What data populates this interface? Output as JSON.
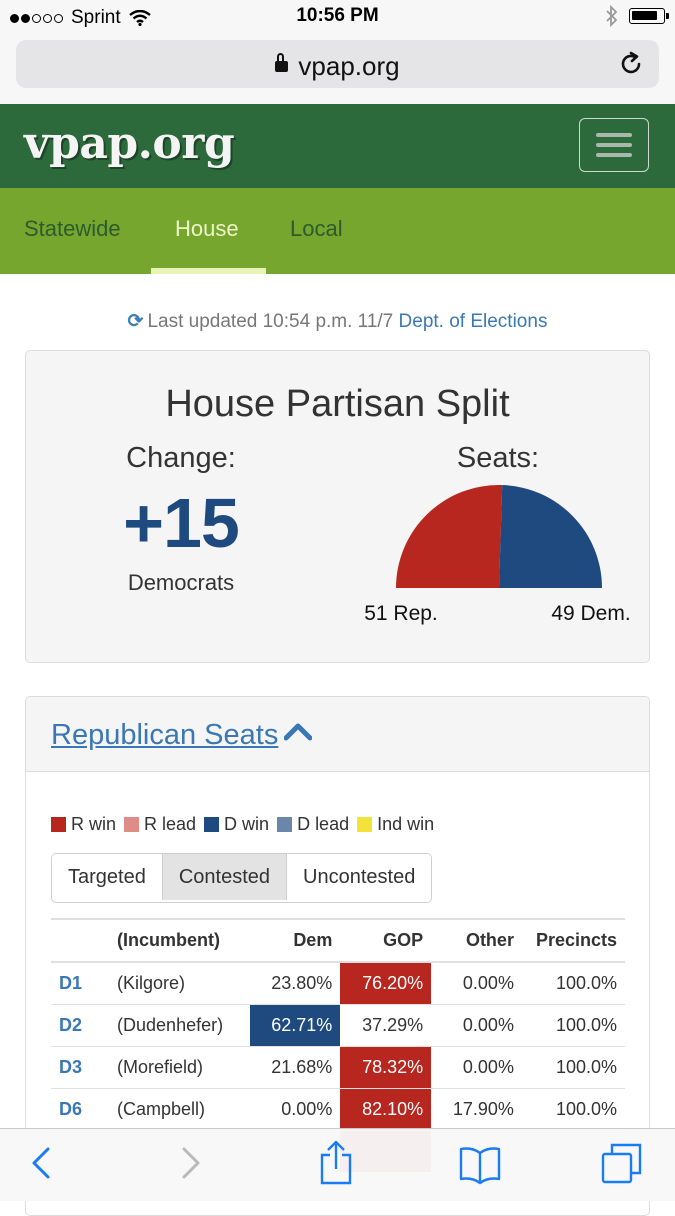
{
  "status_bar": {
    "carrier": "Sprint",
    "time": "10:56 PM",
    "signal_bars_filled": 2,
    "signal_bars_total": 5,
    "battery_level": 0.85
  },
  "browser": {
    "url": "vpap.org"
  },
  "site": {
    "brand": "vpap.org",
    "nav": [
      {
        "label": "Statewide",
        "active": false
      },
      {
        "label": "House",
        "active": true
      },
      {
        "label": "Local",
        "active": false
      }
    ]
  },
  "updated": {
    "text": "Last updated 10:54 p.m. 11/7",
    "source_link": "Dept. of Elections"
  },
  "split": {
    "title": "House Partisan Split",
    "change_label": "Change:",
    "change_value": "+15",
    "change_party": "Democrats",
    "seats_label": "Seats:",
    "rep_label": "51 Rep.",
    "dem_label": "49 Dem."
  },
  "chart_data": {
    "type": "pie",
    "title": "",
    "categories": [
      "Rep.",
      "Dem."
    ],
    "values": [
      51,
      49
    ],
    "colors": [
      "#b8271f",
      "#1e4a7f"
    ]
  },
  "republican_seats": {
    "title": "Republican Seats",
    "legend": [
      {
        "label": "R win",
        "color": "#b8271f"
      },
      {
        "label": "R lead",
        "color": "#e08c86"
      },
      {
        "label": "D win",
        "color": "#1e4a7f"
      },
      {
        "label": "D lead",
        "color": "#6a86a8"
      },
      {
        "label": "Ind win",
        "color": "#f2e23a"
      }
    ],
    "filters": [
      {
        "label": "Targeted",
        "active": false
      },
      {
        "label": "Contested",
        "active": true
      },
      {
        "label": "Uncontested",
        "active": false
      }
    ],
    "columns": [
      "",
      "(Incumbent)",
      "Dem",
      "GOP",
      "Other",
      "Precincts"
    ],
    "rows": [
      {
        "district": "D1",
        "incumbent": "(Kilgore)",
        "dem": "23.80%",
        "gop": "76.20%",
        "other": "0.00%",
        "precincts": "100.0%",
        "winner": "R"
      },
      {
        "district": "D2",
        "incumbent": "(Dudenhefer)",
        "dem": "62.71%",
        "gop": "37.29%",
        "other": "0.00%",
        "precincts": "100.0%",
        "winner": "D"
      },
      {
        "district": "D3",
        "incumbent": "(Morefield)",
        "dem": "21.68%",
        "gop": "78.32%",
        "other": "0.00%",
        "precincts": "100.0%",
        "winner": "R"
      },
      {
        "district": "D6",
        "incumbent": "(Campbell)",
        "dem": "0.00%",
        "gop": "82.10%",
        "other": "17.90%",
        "precincts": "100.0%",
        "winner": "R"
      }
    ]
  }
}
